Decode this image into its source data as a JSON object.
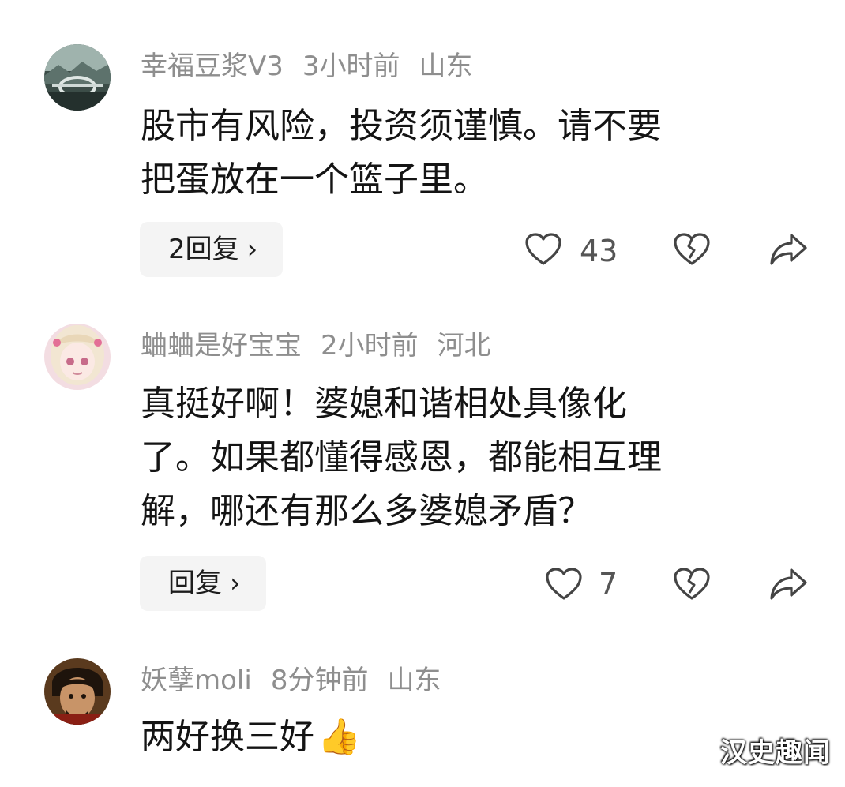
{
  "comments": [
    {
      "username": "幸福豆浆V3",
      "time": "3小时前",
      "location": "山东",
      "text_lines": [
        "股市有风险，投资须谨慎。请不要",
        "把蛋放在一个篮子里。"
      ],
      "reply_label": "2回复",
      "likes": "43"
    },
    {
      "username": "蛐蛐是好宝宝",
      "time": "2小时前",
      "location": "河北",
      "text_lines": [
        "真挺好啊！婆媳和谐相处具像化",
        "了。如果都懂得感恩，都能相互理",
        "解，哪还有那么多婆媳矛盾？"
      ],
      "reply_label": "回复",
      "likes": "7"
    },
    {
      "username": "妖孽moli",
      "time": "8分钟前",
      "location": "山东",
      "text_lines": [
        "两好换三好"
      ],
      "emoji": "👍"
    }
  ],
  "watermark": "汉史趣闻",
  "icons": {
    "like": "heart-outline-icon",
    "dislike": "broken-heart-icon",
    "share": "share-arrow-icon",
    "reply_chevron": "chevron-right-icon"
  },
  "colors": {
    "meta_text": "#8e8e8e",
    "body_text": "#141414",
    "reply_bg": "#f4f4f4",
    "icon_stroke": "#444444"
  }
}
